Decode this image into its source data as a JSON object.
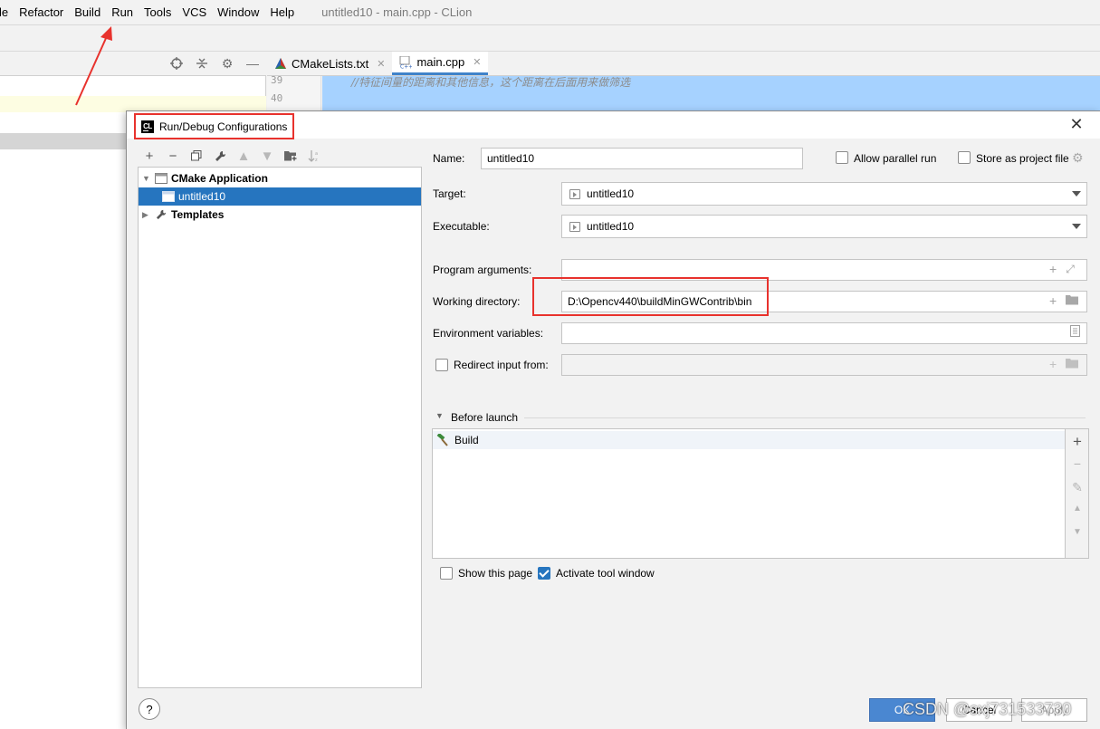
{
  "menubar": {
    "items": [
      "le",
      "Refactor",
      "Build",
      "Run",
      "Tools",
      "VCS",
      "Window",
      "Help"
    ],
    "window_title": "untitled10 - main.cpp - CLion"
  },
  "editor": {
    "tabs": [
      {
        "label": "CMakeLists.txt",
        "icon": "cmake-icon"
      },
      {
        "label": "main.cpp",
        "icon": "cpp-file-icon",
        "active": true
      }
    ],
    "line_numbers": [
      "39",
      "40"
    ],
    "comment": "//特征间量的距离和其他信息，这个距离在后面用来做筛选"
  },
  "dialog": {
    "title": "Run/Debug Configurations",
    "logo_text": "CL",
    "close_label": "✕",
    "tree_toolbar": [
      "plus-icon",
      "minus-icon",
      "copy-icon",
      "wrench-icon",
      "arrow-up-icon",
      "arrow-down-icon",
      "folder-add-icon",
      "sort-icon"
    ],
    "tree": {
      "group": "CMake Application",
      "item": "untitled10",
      "templates": "Templates"
    },
    "form": {
      "name_label": "Name:",
      "name_value": "untitled10",
      "allow_parallel_label": "Allow parallel run",
      "allow_parallel_checked": false,
      "store_project_label": "Store as project file",
      "store_project_checked": false,
      "target_label": "Target:",
      "target_value": "untitled10",
      "executable_label": "Executable:",
      "executable_value": "untitled10",
      "program_args_label": "Program arguments:",
      "program_args_value": "",
      "working_dir_label": "Working directory:",
      "working_dir_value": "D:\\Opencv440\\buildMinGWContrib\\bin",
      "env_vars_label": "Environment variables:",
      "env_vars_value": "",
      "redirect_label": "Redirect input from:",
      "redirect_checked": false
    },
    "before_launch": {
      "header": "Before launch",
      "items": [
        "Build"
      ]
    },
    "show_page_label": "Show this page",
    "show_page_checked": false,
    "activate_tool_label": "Activate tool window",
    "activate_tool_checked": true,
    "buttons": {
      "help": "?",
      "ok": "OK",
      "cancel": "Cancel",
      "apply": "Apply"
    }
  },
  "watermark": "CSDN @sxj731533730",
  "colors": {
    "selection": "#2675bf",
    "annotation_red": "#e8322d",
    "ok_button": "#4a87d1"
  }
}
